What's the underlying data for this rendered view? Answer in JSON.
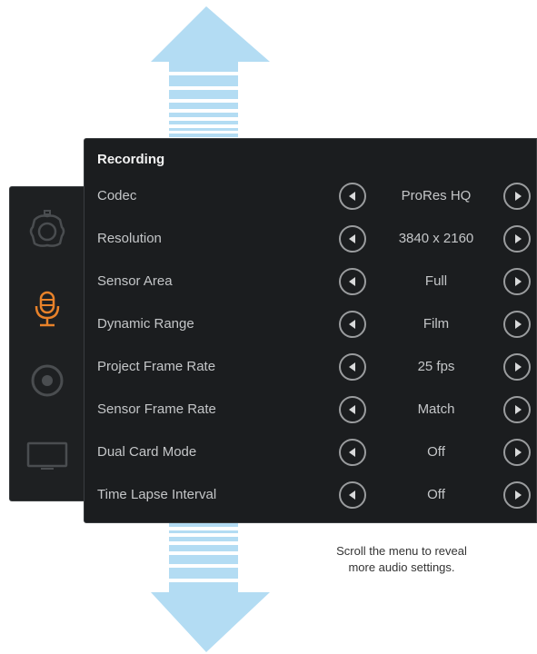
{
  "menu": {
    "title": "Recording",
    "rows": [
      {
        "label": "Codec",
        "value": "ProRes HQ"
      },
      {
        "label": "Resolution",
        "value": "3840 x 2160"
      },
      {
        "label": "Sensor Area",
        "value": "Full"
      },
      {
        "label": "Dynamic Range",
        "value": "Film"
      },
      {
        "label": "Project Frame Rate",
        "value": "25 fps"
      },
      {
        "label": "Sensor Frame Rate",
        "value": "Match"
      },
      {
        "label": "Dual Card Mode",
        "value": "Off"
      },
      {
        "label": "Time Lapse Interval",
        "value": "Off"
      }
    ]
  },
  "sidebar": {
    "tabs": [
      {
        "icon": "camera-icon",
        "active": false
      },
      {
        "icon": "microphone-icon",
        "active": true
      },
      {
        "icon": "record-icon",
        "active": false
      },
      {
        "icon": "monitor-icon",
        "active": false
      }
    ]
  },
  "caption": {
    "line1": "Scroll the menu to reveal",
    "line2": "more audio settings."
  },
  "colors": {
    "arrow": "#b3dcf3",
    "active_tab": "#e8822a",
    "inactive_tab": "#4a4d50",
    "panel_bg": "#1b1d1f",
    "text": "#c4c6c8"
  }
}
